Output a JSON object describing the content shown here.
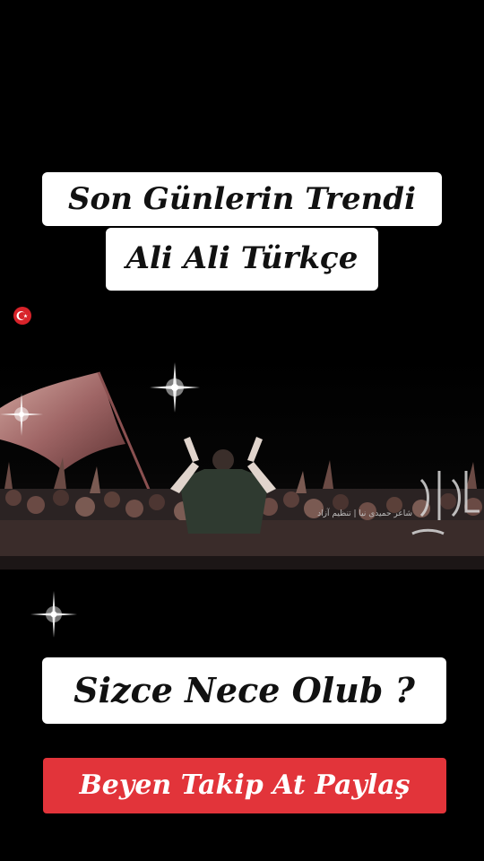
{
  "captions": {
    "line1": "Son Günlerin Trendi",
    "line2": "Ali Ali Türkçe",
    "question": "Sizce Nece Olub ?",
    "cta": "Beyen Takip At Paylaş"
  },
  "icons": {
    "flag": "turkey-flag-icon"
  },
  "colors": {
    "background": "#000000",
    "caption_bg": "#ffffff",
    "cta_bg": "#e2343a",
    "cta_text": "#ffffff"
  }
}
